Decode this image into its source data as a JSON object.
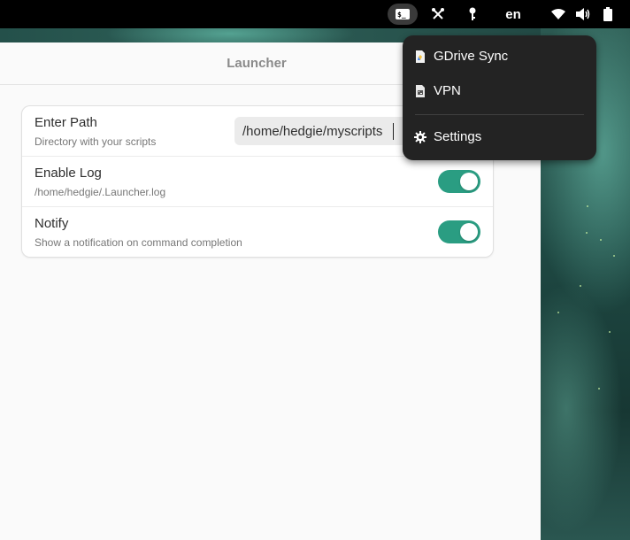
{
  "topbar": {
    "terminal_glyph": "$_",
    "language": "en",
    "icons": [
      "terminal-icon",
      "tools-icon",
      "key-icon",
      "wifi-icon",
      "volume-icon",
      "battery-icon"
    ]
  },
  "window": {
    "title": "Launcher"
  },
  "settings": {
    "path": {
      "title": "Enter Path",
      "subtitle": "Directory with your scripts",
      "value": "/home/hedgie/myscripts"
    },
    "log": {
      "title": "Enable Log",
      "subtitle": "/home/hedgie/.Launcher.log",
      "enabled": true
    },
    "notify": {
      "title": "Notify",
      "subtitle": "Show a notification on command completion",
      "enabled": true
    }
  },
  "menu": {
    "items": [
      {
        "label": "GDrive Sync",
        "icon": "document-icon"
      },
      {
        "label": "VPN",
        "icon": "script-icon"
      },
      {
        "label": "Settings",
        "icon": "gear-icon"
      }
    ]
  },
  "colors": {
    "switch_on": "#2a9d82",
    "menu_bg": "#232323",
    "topbar_bg": "#000000"
  }
}
